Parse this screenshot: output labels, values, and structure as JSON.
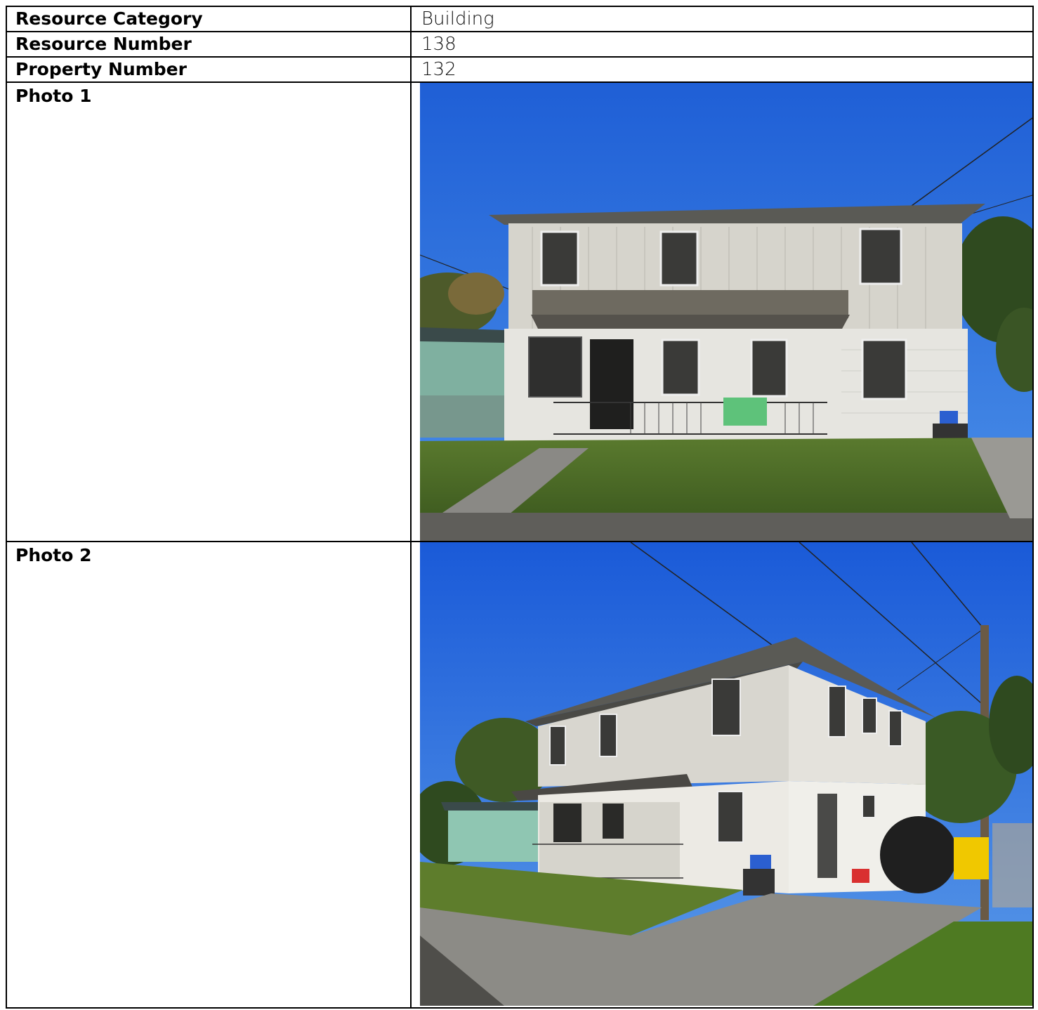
{
  "table": {
    "rows": [
      {
        "label": "Resource Category",
        "value": "Building"
      },
      {
        "label": "Resource Number",
        "value": "138"
      },
      {
        "label": "Property Number",
        "value": "132"
      }
    ],
    "photos": [
      {
        "label": "Photo 1"
      },
      {
        "label": "Photo 2"
      }
    ]
  }
}
